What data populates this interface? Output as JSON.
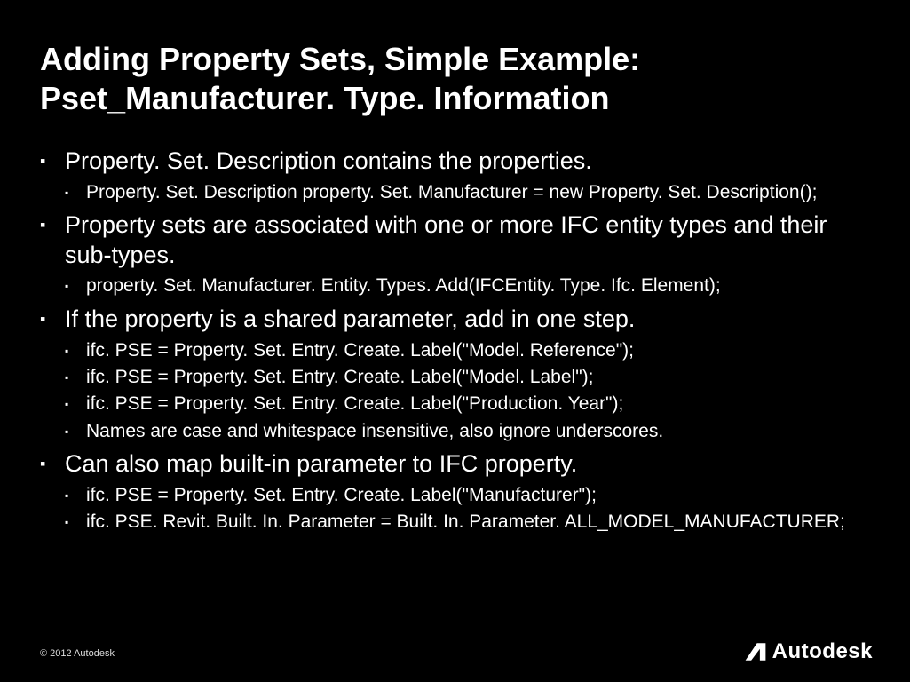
{
  "title": "Adding Property Sets, Simple Example: Pset_Manufacturer. Type. Information",
  "bullets": [
    {
      "text": "Property. Set. Description contains the properties.",
      "sub": [
        "Property. Set. Description property. Set. Manufacturer = new Property. Set. Description();"
      ]
    },
    {
      "text": "Property sets are associated with one or more IFC entity types and their sub-types.",
      "sub": [
        "property. Set. Manufacturer. Entity. Types. Add(IFCEntity. Type. Ifc. Element);"
      ]
    },
    {
      "text": "If the property is a shared parameter, add in one step.",
      "sub": [
        "ifc. PSE = Property. Set. Entry. Create. Label(\"Model. Reference\");",
        "ifc. PSE = Property. Set. Entry. Create. Label(\"Model. Label\");",
        "ifc. PSE = Property. Set. Entry. Create. Label(\"Production. Year\");",
        "Names are case and whitespace insensitive, also ignore underscores."
      ]
    },
    {
      "text": "Can also map built-in parameter to IFC property.",
      "sub": [
        "ifc. PSE = Property. Set. Entry. Create. Label(\"Manufacturer\");",
        "ifc. PSE. Revit. Built. In. Parameter = Built. In. Parameter. ALL_MODEL_MANUFACTURER;"
      ]
    }
  ],
  "footer": "© 2012 Autodesk",
  "logo_text": "Autodesk"
}
